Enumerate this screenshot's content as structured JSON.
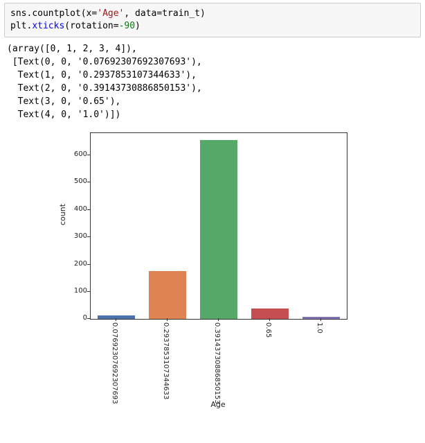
{
  "code": {
    "line1_a": "sns.",
    "line1_b": "countplot",
    "line1_c": "(x=",
    "line1_d": "'Age'",
    "line1_e": ", data=train_t)",
    "line2_a": "plt.",
    "line2_b": "xticks",
    "line2_c": "(rotation=",
    "line2_d": "-90",
    "line2_e": ")"
  },
  "output": "(array([0, 1, 2, 3, 4]),\n [Text(0, 0, '0.07692307692307693'),\n  Text(1, 0, '0.2937853107344633'),\n  Text(2, 0, '0.39143730886850153'),\n  Text(3, 0, '0.65'),\n  Text(4, 0, '1.0')])",
  "chart_data": {
    "type": "bar",
    "categories": [
      "0.07692307692307693",
      "0.2937853107344633",
      "0.39143730886850153",
      "0.65",
      "1.0"
    ],
    "values": [
      15,
      175,
      655,
      40,
      10
    ],
    "colors": [
      "#4c72b0",
      "#dd8452",
      "#55a868",
      "#c44e52",
      "#8172b3"
    ],
    "xlabel": "Age",
    "ylabel": "count",
    "yticks": [
      0,
      100,
      200,
      300,
      400,
      500,
      600
    ],
    "ylim": [
      0,
      680
    ]
  }
}
